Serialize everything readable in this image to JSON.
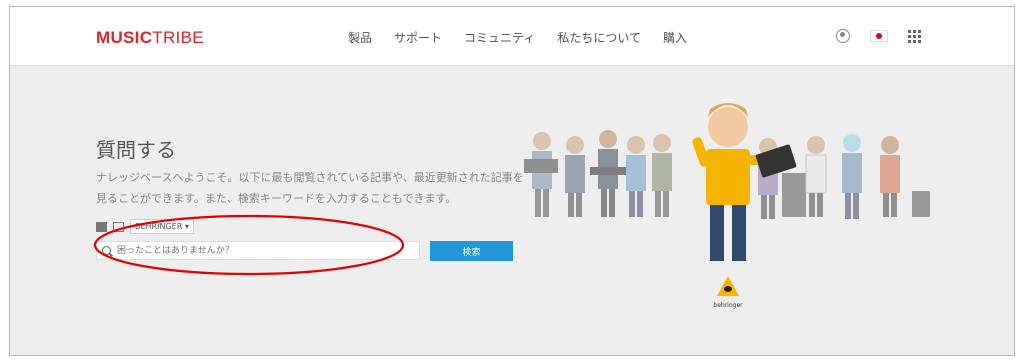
{
  "header": {
    "logo_bold": "MUSIC",
    "logo_light": "TRIBE",
    "nav": [
      "製品",
      "サポート",
      "コミュニティ",
      "私たちについて",
      "購入"
    ],
    "icons": [
      "user-icon",
      "japan-flag-icon",
      "apps-grid-icon"
    ]
  },
  "hero": {
    "title": "質問する",
    "description": "ナレッジベースへようこそ。以下に最も閲覧されている記事や、最近更新された記事を見ることができます。また、検索キーワードを入力することもできます。",
    "brand_select": "BEHRINGER ▾",
    "search_placeholder": "困ったことはありませんか？",
    "search_button": "検索"
  },
  "illustration": {
    "brand_logo_text": "behringer"
  },
  "colors": {
    "brand_red": "#e2222b",
    "button_blue": "#2296d8",
    "annotation_red": "#e60000",
    "character_yellow": "#f5b400"
  }
}
